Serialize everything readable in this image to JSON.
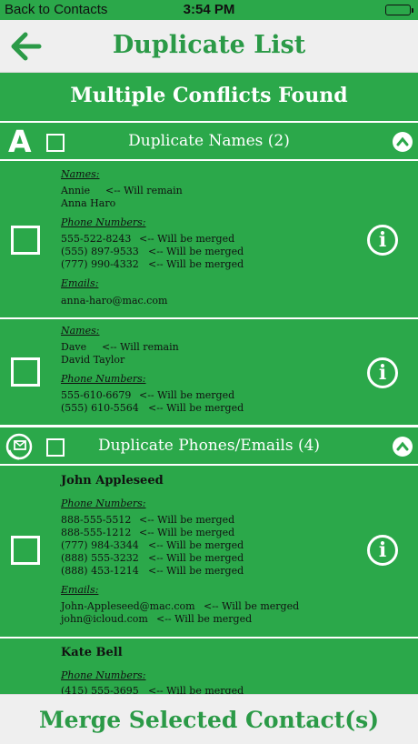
{
  "status_bar": {
    "back_label": "Back to Contacts",
    "time": "3:54 PM"
  },
  "nav": {
    "title": "Duplicate List"
  },
  "banner": {
    "title": "Multiple Conflicts Found"
  },
  "colors": {
    "accent": "#2ba84a",
    "title_green": "#2b9a47"
  },
  "sections": [
    {
      "letter": "A",
      "title": "Duplicate Names (2)"
    },
    {
      "icon": "phone-email-icon",
      "title": "Duplicate Phones/Emails (4)"
    }
  ],
  "labels": {
    "names": "Names:",
    "phones": "Phone Numbers:",
    "emails": "Emails:"
  },
  "cards": [
    {
      "names": [
        {
          "value": "Annie",
          "note": "<-- Will remain"
        },
        {
          "value": "Anna Haro",
          "note": ""
        }
      ],
      "phones": [
        {
          "value": "555-522-8243",
          "note": "<-- Will be merged"
        },
        {
          "value": "(555) 897-9533",
          "note": "<-- Will be merged"
        },
        {
          "value": "(777) 990-4332",
          "note": "<-- Will be merged"
        }
      ],
      "emails": [
        {
          "value": "anna-haro@mac.com",
          "note": ""
        }
      ]
    },
    {
      "names": [
        {
          "value": "Dave",
          "note": "<-- Will remain"
        },
        {
          "value": "David Taylor",
          "note": ""
        }
      ],
      "phones": [
        {
          "value": "555-610-6679",
          "note": "<-- Will be merged"
        },
        {
          "value": "(555) 610-5564",
          "note": "<-- Will be merged"
        }
      ]
    },
    {
      "title": "John Appleseed",
      "phones": [
        {
          "value": "888-555-5512",
          "note": "<-- Will be merged"
        },
        {
          "value": "888-555-1212",
          "note": "<-- Will be merged"
        },
        {
          "value": "(777) 984-3344",
          "note": "<-- Will be merged"
        },
        {
          "value": "(888) 555-3232",
          "note": "<-- Will be merged"
        },
        {
          "value": "(888) 453-1214",
          "note": "<-- Will be merged"
        }
      ],
      "emails": [
        {
          "value": "John-Appleseed@mac.com",
          "note": "<-- Will be merged"
        },
        {
          "value": "john@icloud.com",
          "note": "<-- Will be merged"
        }
      ]
    },
    {
      "title": "Kate Bell",
      "phones": [
        {
          "value": "(415) 555-3695",
          "note": "<-- Will be merged"
        }
      ]
    }
  ],
  "merge_button": "Merge Selected Contact(s)"
}
